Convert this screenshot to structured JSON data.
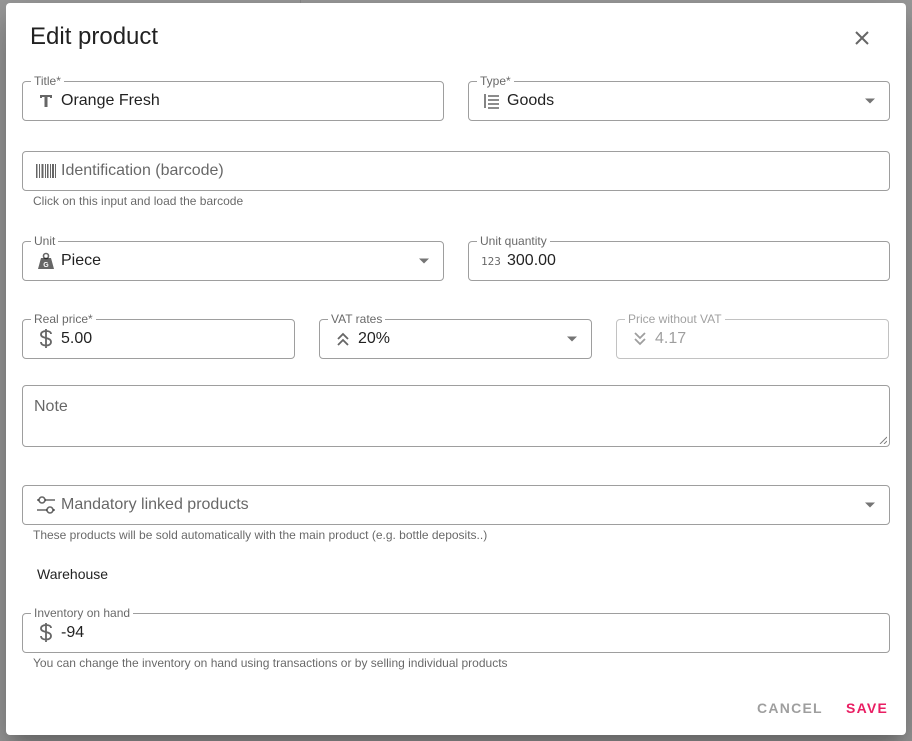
{
  "dialog": {
    "title": "Edit product"
  },
  "fields": {
    "title": {
      "label": "Title*",
      "value": "Orange Fresh"
    },
    "type": {
      "label": "Type*",
      "value": "Goods"
    },
    "barcode": {
      "placeholder": "Identification (barcode)",
      "hint": "Click on this input and load the barcode"
    },
    "unit": {
      "label": "Unit",
      "value": "Piece"
    },
    "unit_quantity": {
      "label": "Unit quantity",
      "value": "300.00"
    },
    "real_price": {
      "label": "Real price*",
      "value": "5.00"
    },
    "vat_rates": {
      "label": "VAT rates",
      "value": "20%"
    },
    "price_without_vat": {
      "label": "Price without VAT",
      "value": "4.17"
    },
    "note": {
      "placeholder": "Note"
    },
    "linked_products": {
      "placeholder": "Mandatory linked products",
      "hint": "These products will be sold automatically with the main product (e.g. bottle deposits..)"
    },
    "inventory": {
      "label": "Inventory on hand",
      "value": "-94",
      "hint": "You can change the inventory on hand using transactions or by selling individual products"
    }
  },
  "sections": {
    "warehouse": "Warehouse"
  },
  "actions": {
    "cancel": "CANCEL",
    "save": "SAVE"
  },
  "colors": {
    "accent": "#e91e63",
    "overlay": "#9b9b9b"
  },
  "icons": [
    "close-icon",
    "text-icon",
    "list-icon",
    "barcode-icon",
    "weight-icon",
    "numeric-icon",
    "dollar-icon",
    "double-chevron-up-icon",
    "double-chevron-down-icon",
    "tune-icon",
    "caret-down-icon"
  ]
}
